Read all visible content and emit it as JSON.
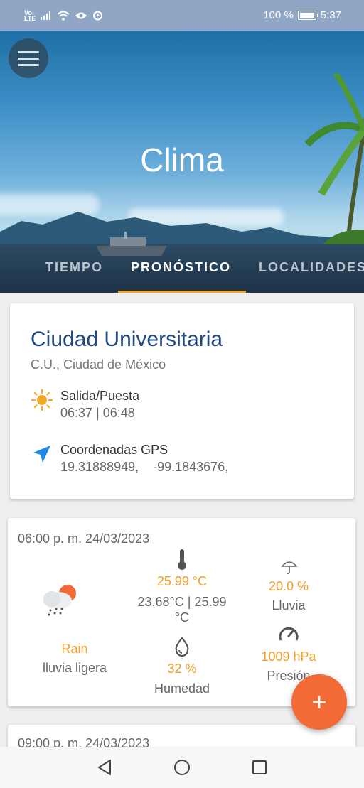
{
  "status_bar": {
    "signal_text": "Vo LTE",
    "battery": "100 %",
    "time": "5:37"
  },
  "header": {
    "title": "Clima"
  },
  "tabs": [
    {
      "label": "TIEMPO"
    },
    {
      "label": "PRONÓSTICO"
    },
    {
      "label": "LOCALIDADES"
    }
  ],
  "location": {
    "city": "Ciudad Universitaria",
    "subtitle": "C.U., Ciudad de México",
    "sun_label": "Salida/Puesta",
    "sun_value": "06:37 | 06:48",
    "gps_label": "Coordenadas GPS",
    "gps_value": "19.31888949,    -99.1843676,"
  },
  "forecast": {
    "datetime": "06:00 p. m. 24/03/2023",
    "temp": "25.99 °C",
    "temp_range": "23.68°C | 25.99 °C",
    "rain_prob": "20.0 %",
    "rain_label": "Lluvia",
    "condition": "Rain",
    "condition_desc": "lluvia ligera",
    "humidity": "32 %",
    "humidity_label": "Humedad",
    "pressure": "1009 hPa",
    "pressure_label": "Presión"
  },
  "forecast2": {
    "datetime": "09:00 p. m. 24/03/2023"
  },
  "fab": {
    "label": "+"
  },
  "colors": {
    "accent": "#f5a623",
    "fab": "#f26a35",
    "city": "#1f4a85"
  }
}
